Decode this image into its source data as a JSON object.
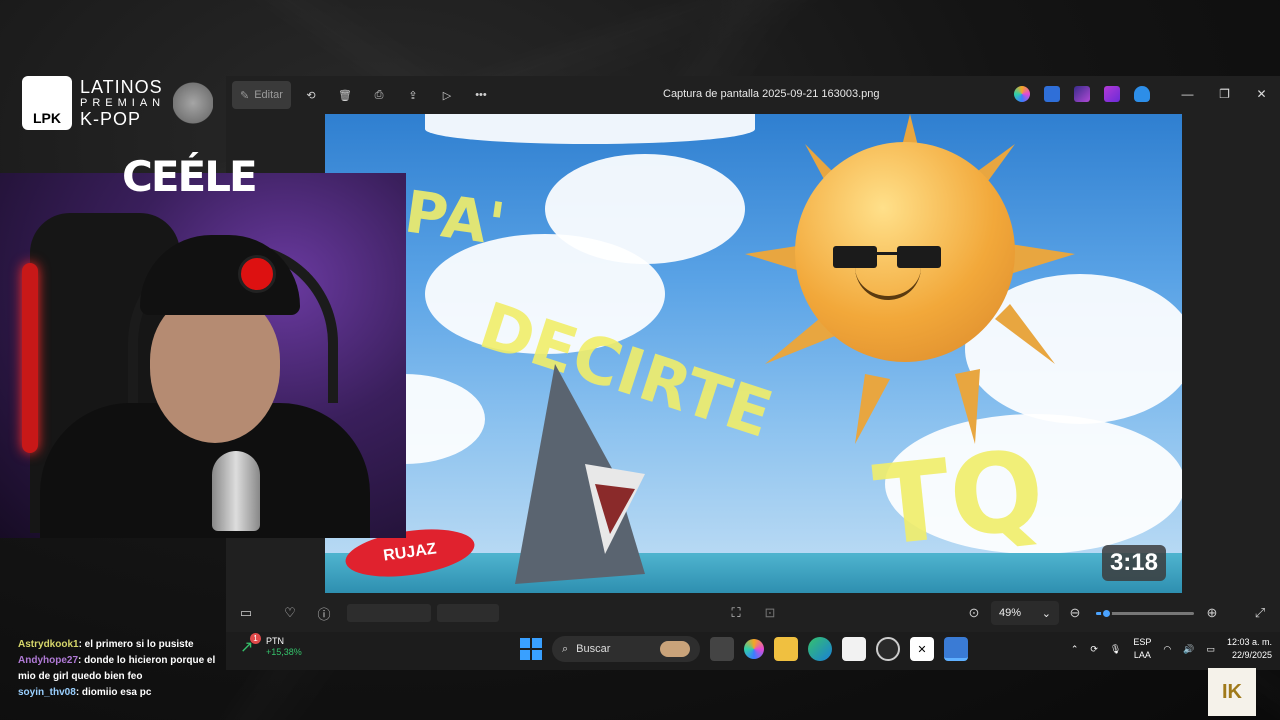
{
  "overlay": {
    "logo_mark": "LPK",
    "logo_line1": "LATINOS",
    "logo_line2": "PREMIAN",
    "logo_line3": "K-POP",
    "cam_title": "CEÉLE",
    "corner_logo": "IK"
  },
  "viewer": {
    "edit_label": "Editar",
    "title": "Captura de pantalla 2025-09-21 163003.png",
    "video_badge": "3:18",
    "image_text": [
      "PA'",
      "DECIRTE",
      "TQ"
    ],
    "sticker_text": "RUJAZ",
    "zoom_value": "49%",
    "zoom_level": 0.1,
    "accent": "#4aa3ff"
  },
  "taskbar": {
    "stock_name": "PTN",
    "stock_change": "+15,38%",
    "stock_badge": "1",
    "search_placeholder": "Buscar",
    "lang_line1": "ESP",
    "lang_line2": "LAA",
    "time": "12:03 a. m.",
    "date": "22/9/2025"
  },
  "chat": [
    {
      "user": "Astrydkook1",
      "text": ": el primero si lo pusiste"
    },
    {
      "user": "Andyhope27",
      "text": ": donde lo hicieron porque el mio de girl quedo bien feo"
    },
    {
      "user": "soyin_thv08",
      "text": ": diomiio esa pc"
    }
  ]
}
